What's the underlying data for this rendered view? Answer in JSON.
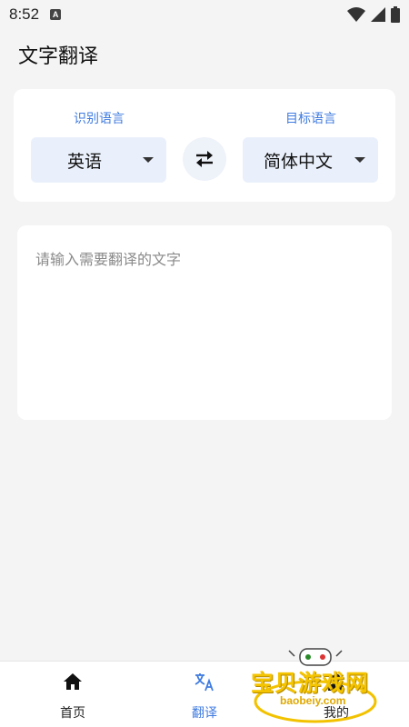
{
  "status_bar": {
    "time": "8:52",
    "notification_icon": "A",
    "icons": [
      "wifi-icon",
      "signal-icon",
      "battery-icon"
    ]
  },
  "header": {
    "title": "文字翻译"
  },
  "language_panel": {
    "source_label": "识别语言",
    "target_label": "目标语言",
    "source_value": "英语",
    "target_value": "简体中文",
    "swap_icon": "swap-arrows-icon",
    "accent_color": "#3f7be0"
  },
  "input": {
    "placeholder": "请输入需要翻译的文字",
    "value": ""
  },
  "bottom_nav": {
    "items": [
      {
        "label": "首页",
        "icon": "home-icon"
      },
      {
        "label": "翻译",
        "icon": "translate-icon"
      },
      {
        "label": "我的",
        "icon": "user-icon"
      }
    ],
    "active_index": 1
  },
  "watermark": {
    "title": "宝贝游戏网",
    "url": "baobeiy.com"
  }
}
